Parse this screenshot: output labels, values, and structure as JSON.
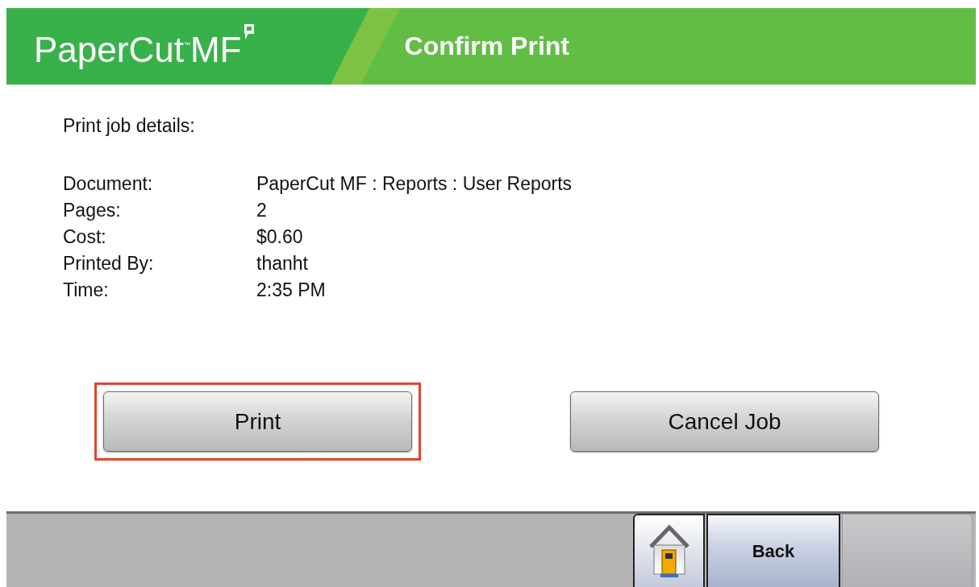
{
  "header": {
    "logo": {
      "name": "PaperCut",
      "trademark": "™",
      "suffix": "MF"
    },
    "title": "Confirm Print"
  },
  "details": {
    "heading": "Print job details:",
    "rows": [
      {
        "label": "Document:",
        "value": "PaperCut MF : Reports : User Reports"
      },
      {
        "label": "Pages:",
        "value": "2"
      },
      {
        "label": "Cost:",
        "value": "$0.60"
      },
      {
        "label": "Printed By:",
        "value": "thanht"
      },
      {
        "label": "Time:",
        "value": "2:35 PM"
      }
    ]
  },
  "actions": [
    {
      "label": "Print",
      "highlighted": true
    },
    {
      "label": "Cancel Job",
      "highlighted": false
    }
  ],
  "footer": {
    "buttons": [
      {
        "kind": "home"
      },
      {
        "kind": "text",
        "label": "Back"
      },
      {
        "kind": "blank"
      }
    ]
  }
}
